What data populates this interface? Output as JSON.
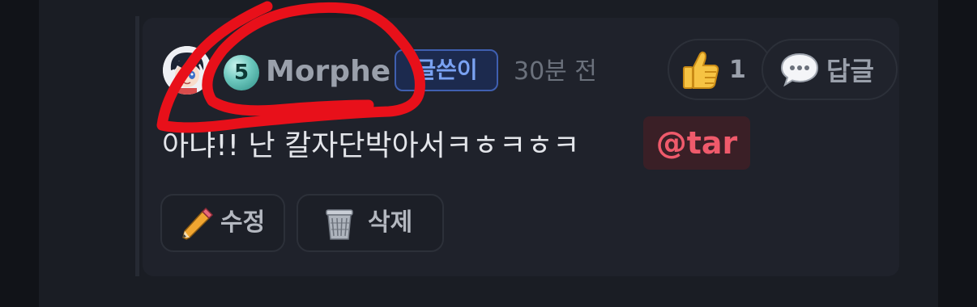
{
  "comment": {
    "user": {
      "level": "5",
      "name": "Morphe",
      "badge": "글쓴이",
      "avatar_icon": "avatar-icon",
      "level_icon": "level-badge-icon"
    },
    "timestamp": "30분 전",
    "like": {
      "icon": "thumbs-up-icon",
      "count": "1"
    },
    "reply": {
      "icon": "speech-bubble-icon",
      "label": "답글"
    },
    "text": "아냐!! 난 칼자단박아서ㅋㅎㅋㅎㅋ",
    "mention": "@tar",
    "actions": {
      "edit": {
        "icon": "pencil-icon",
        "label": "수정"
      },
      "delete": {
        "icon": "trash-can-icon",
        "label": "삭제"
      }
    }
  },
  "colors": {
    "background": "#111318",
    "card": "#1f222b",
    "badge_border": "#3f5fb0",
    "badge_text": "#7aa2f2",
    "mention_text": "#ef5a6b",
    "mention_bg": "#3a1f26",
    "scribble": "#e8101a"
  }
}
